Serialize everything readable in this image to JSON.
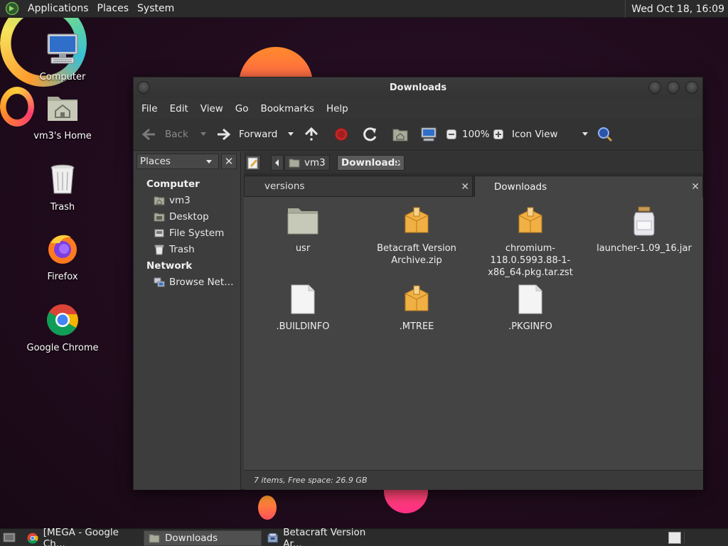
{
  "top_panel": {
    "menus": [
      "Applications",
      "Places",
      "System"
    ],
    "clock": "Wed Oct 18, 16:09"
  },
  "desktop": {
    "icons": [
      {
        "label": "Computer",
        "icon": "computer-icon"
      },
      {
        "label": "vm3's Home",
        "icon": "home-folder-icon"
      },
      {
        "label": "Trash",
        "icon": "trash-icon"
      },
      {
        "label": "Firefox",
        "icon": "firefox-icon"
      },
      {
        "label": "Google Chrome",
        "icon": "chrome-icon"
      }
    ]
  },
  "window": {
    "title": "Downloads",
    "menubar": [
      "File",
      "Edit",
      "View",
      "Go",
      "Bookmarks",
      "Help"
    ],
    "toolbar": {
      "back": "Back",
      "forward": "Forward",
      "zoom": "100%",
      "view_mode": "Icon View"
    },
    "sidepane": {
      "header": "Places",
      "sections": [
        {
          "title": "Computer",
          "items": [
            "vm3",
            "Desktop",
            "File System",
            "Trash"
          ]
        },
        {
          "title": "Network",
          "items": [
            "Browse Net…"
          ]
        }
      ]
    },
    "pathbar": {
      "crumbs": [
        "vm3",
        "Downloads"
      ]
    },
    "tabs": [
      {
        "label": "versions"
      },
      {
        "label": "Downloads"
      }
    ],
    "files": [
      {
        "name": "usr",
        "type": "folder"
      },
      {
        "name": "Betacraft Version Archive.zip",
        "type": "archive"
      },
      {
        "name": "chromium-118.0.5993.88-1-x86_64.pkg.tar.zst",
        "type": "archive"
      },
      {
        "name": "launcher-1.09_16.jar",
        "type": "jar"
      },
      {
        "name": ".BUILDINFO",
        "type": "text"
      },
      {
        "name": ".MTREE",
        "type": "archive"
      },
      {
        "name": ".PKGINFO",
        "type": "text"
      }
    ],
    "status": "7 items, Free space: 26.9 GB"
  },
  "taskbar": {
    "tasks": [
      {
        "label": "[MEGA - Google Ch...",
        "icon": "chrome-icon"
      },
      {
        "label": "Downloads",
        "icon": "folder-icon",
        "active": true
      },
      {
        "label": "Betacraft Version Ar...",
        "icon": "archive-manager-icon"
      }
    ]
  }
}
